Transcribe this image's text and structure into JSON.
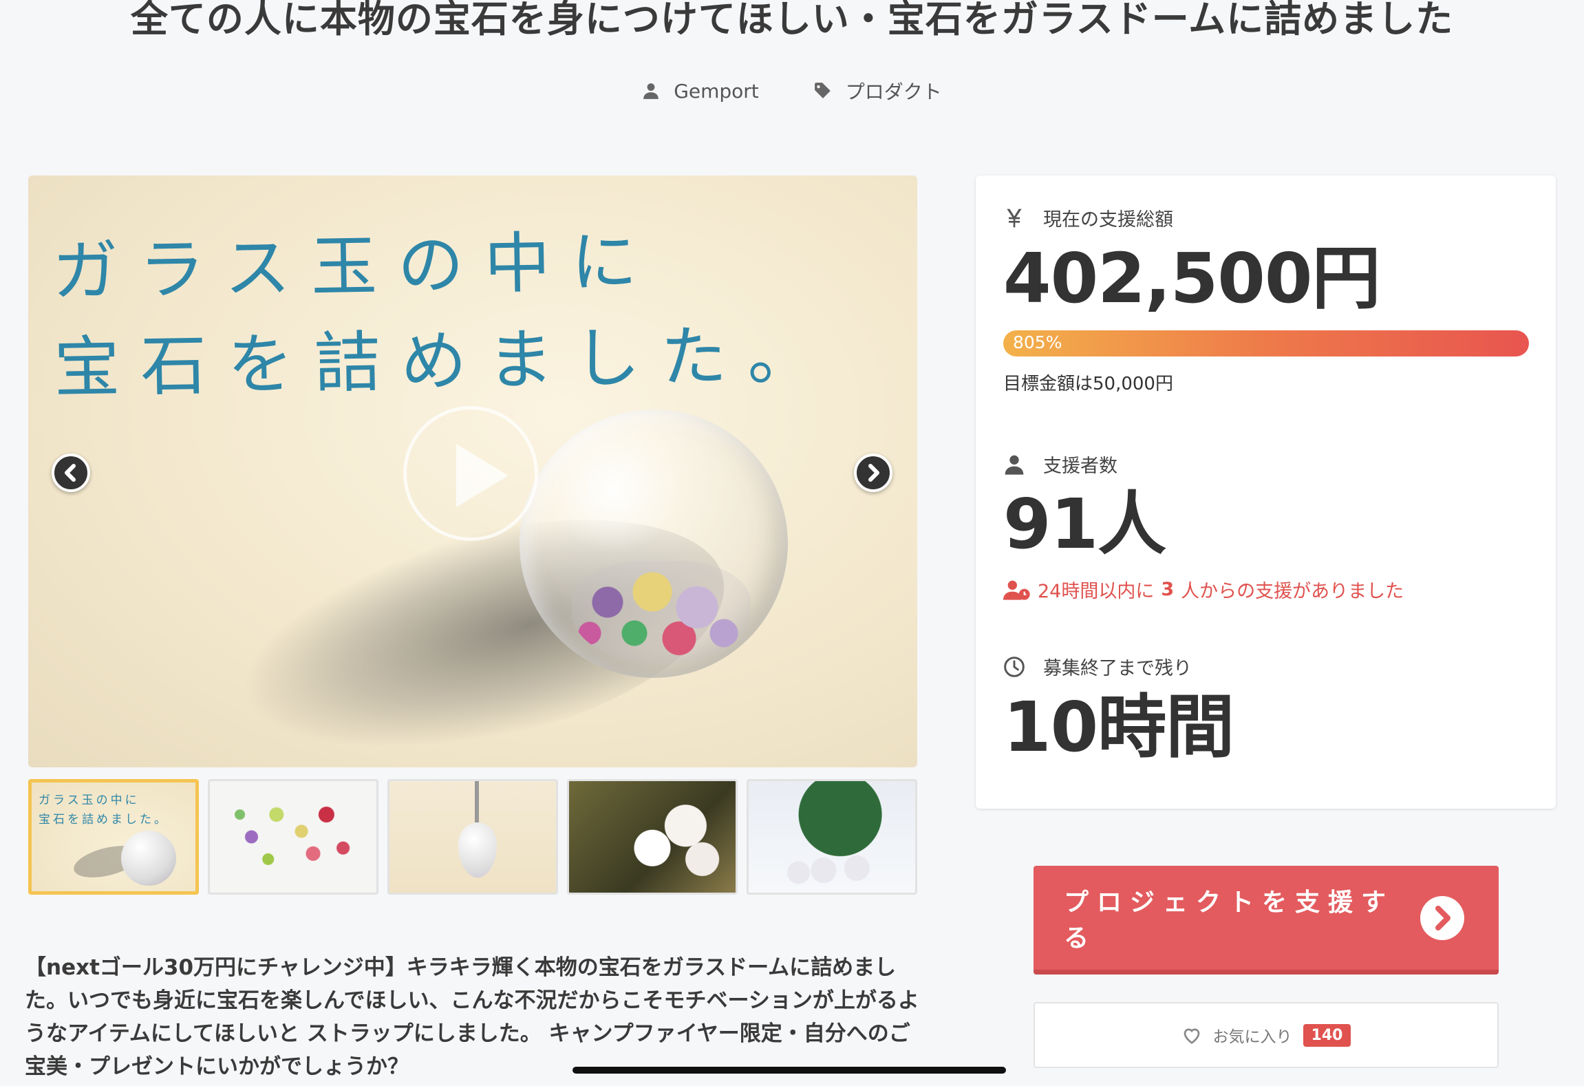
{
  "header": {
    "title": "全ての人に本物の宝石を身につけてほしい・宝石をガラスドームに詰めました",
    "author": "Gemport",
    "category": "プロダクト"
  },
  "hero": {
    "caption_line1": "ガラス玉の中に",
    "caption_line2": "宝石を詰めました。",
    "icons": {
      "play": "play-icon",
      "prev": "chevron-left-icon",
      "next": "chevron-right-icon"
    }
  },
  "thumbnails": {
    "active_index": 0,
    "first_caption_line1": "ガラス玉の中に",
    "first_caption_line2": "宝石を詰めました。"
  },
  "description": "【nextゴール30万円にチャレンジ中】キラキラ輝く本物の宝石をガラスドームに詰めました。いつでも身近に宝石を楽しんでほしい、こんな不況だからこそモチベーションが上がるようなアイテムにしてほしいと ストラップにしました。 キャンプファイヤー限定・自分へのご宝美・プレゼントにいかがでしょうか？",
  "stats": {
    "total_label": "現在の支援総額",
    "total_value": "402,500円",
    "progress_text": "805%",
    "progress_percent": 805,
    "goal_text": "目標金額は50,000円",
    "backers_label": "支援者数",
    "backers_value": "91人",
    "recent_prefix": "24時間以内に",
    "recent_count": "3",
    "recent_suffix": "人からの支援がありました",
    "remaining_label": "募集終了まで残り",
    "remaining_value": "10時間"
  },
  "actions": {
    "support_label": "プロジェクトを支援する",
    "favorite_label": "お気に入り",
    "favorite_count": "140"
  },
  "colors": {
    "accent": "#e35b5e",
    "caption_blue": "#2e86a8",
    "progress_start": "#f3b14a",
    "progress_end": "#e8554f",
    "thumb_active_border": "#f5c451"
  }
}
